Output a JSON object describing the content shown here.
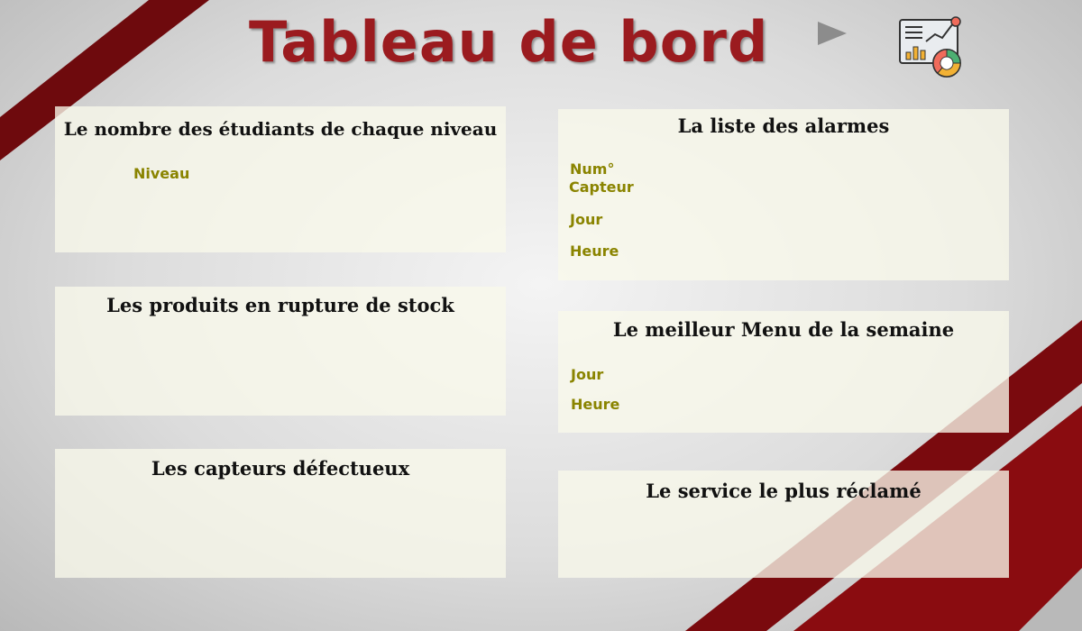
{
  "header": {
    "title": "Tableau de bord"
  },
  "colors": {
    "accent": "#9b1b1f",
    "stripe": "#7a0a0e",
    "panel": "#f7f7e8",
    "label": "#8a8400"
  },
  "icons": {
    "play": "play-triangle-icon",
    "dashboard": "dashboard-analytics-icon"
  },
  "cards": {
    "etudiants": {
      "title": "Le nombre des étudiants de chaque niveau",
      "labels": [
        "Niveau"
      ]
    },
    "rupture": {
      "title": "Les produits en rupture de stock"
    },
    "capteurs": {
      "title": "Les capteurs défectueux"
    },
    "alarmes": {
      "title": "La liste des alarmes",
      "labels": [
        "Num°",
        "Capteur",
        "Jour",
        "Heure"
      ]
    },
    "menu": {
      "title": "Le meilleur Menu de la semaine",
      "labels": [
        "Jour",
        "Heure"
      ]
    },
    "service": {
      "title": "Le service le plus réclamé"
    }
  }
}
